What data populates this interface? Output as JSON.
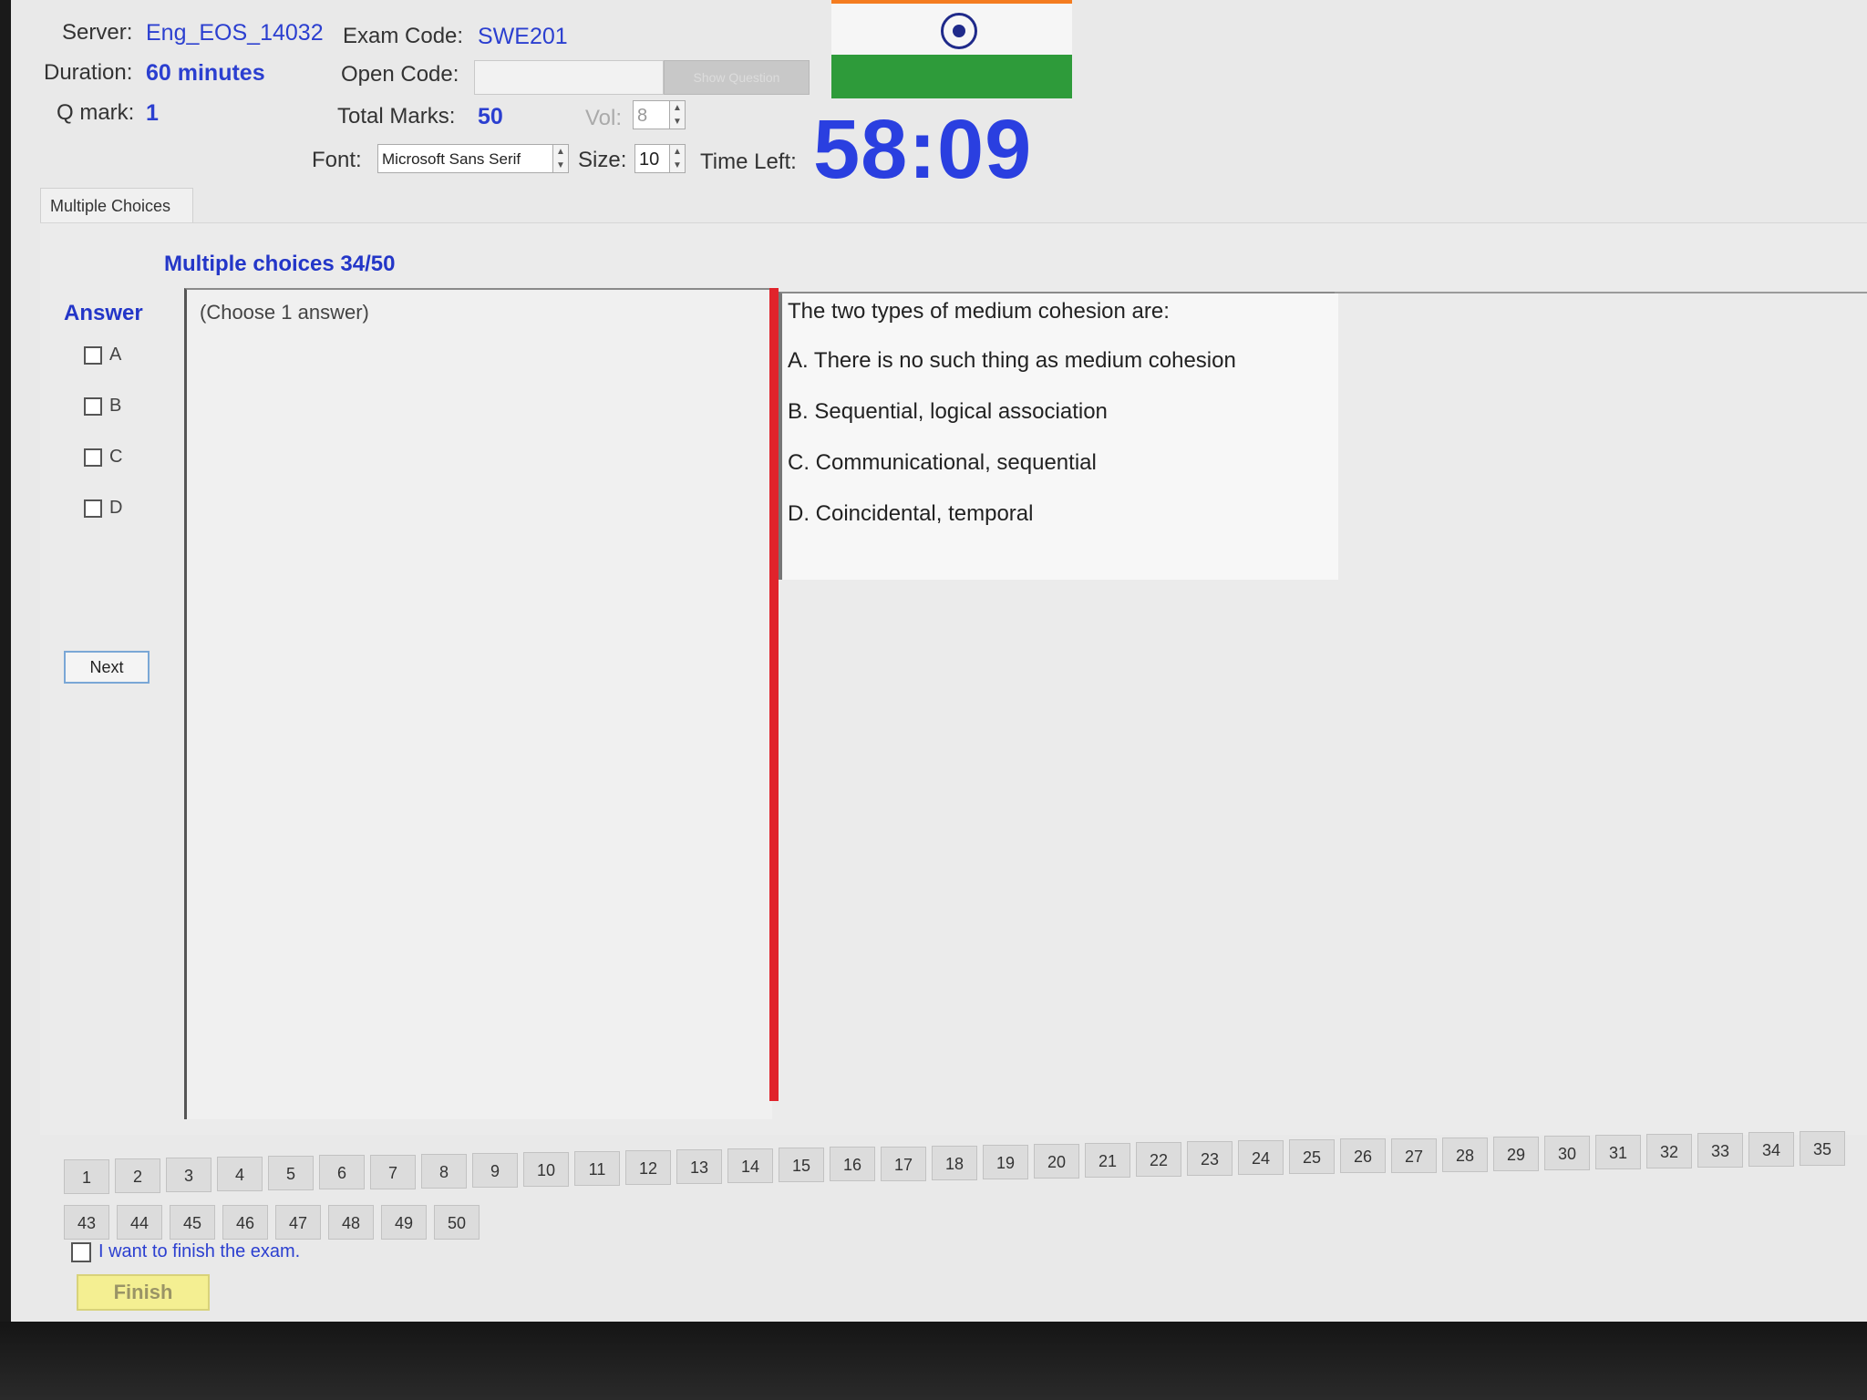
{
  "header": {
    "server_label": "Server:",
    "server_value": "Eng_EOS_14032",
    "exam_code_label": "Exam Code:",
    "exam_code_value": "SWE201",
    "duration_label": "Duration:",
    "duration_value": "60 minutes",
    "open_code_label": "Open Code:",
    "open_code_value": "",
    "show_question_label": "Show Question",
    "qmark_label": "Q mark:",
    "qmark_value": "1",
    "total_marks_label": "Total Marks:",
    "total_marks_value": "50",
    "vol_label": "Vol:",
    "vol_value": "8",
    "font_label": "Font:",
    "font_value": "Microsoft Sans Serif",
    "size_label": "Size:",
    "size_value": "10",
    "time_left_label": "Time Left:",
    "time_left_value": "58:09"
  },
  "tab_label": "Multiple Choices",
  "mc_heading": "Multiple choices 34/50",
  "answer": {
    "label": "Answer",
    "options": [
      "A",
      "B",
      "C",
      "D"
    ],
    "next_label": "Next"
  },
  "answer_hint": "(Choose 1 answer)",
  "question": {
    "stem": "The two types of medium cohesion are:",
    "options": [
      "A.  There is no such thing as medium cohesion",
      "B.  Sequential, logical association",
      "C.  Communicational, sequential",
      "D.  Coincidental, temporal"
    ]
  },
  "nav": {
    "row1": [
      "1",
      "2",
      "3",
      "4",
      "5",
      "6",
      "7",
      "8",
      "9",
      "10",
      "11",
      "12",
      "13",
      "14",
      "15",
      "16",
      "17",
      "18",
      "19",
      "20",
      "21",
      "22",
      "23",
      "24",
      "25",
      "26",
      "27",
      "28",
      "29",
      "30",
      "31",
      "32",
      "33",
      "34",
      "35"
    ],
    "row2": [
      "43",
      "44",
      "45",
      "46",
      "47",
      "48",
      "49",
      "50"
    ]
  },
  "finish": {
    "checkbox_label": "I want to finish the exam.",
    "button_label": "Finish"
  },
  "colors": {
    "accent": "#2b3fd0",
    "timer": "#2a3fe0",
    "divider": "#e0232b",
    "finish_button": "#f4ef92"
  }
}
